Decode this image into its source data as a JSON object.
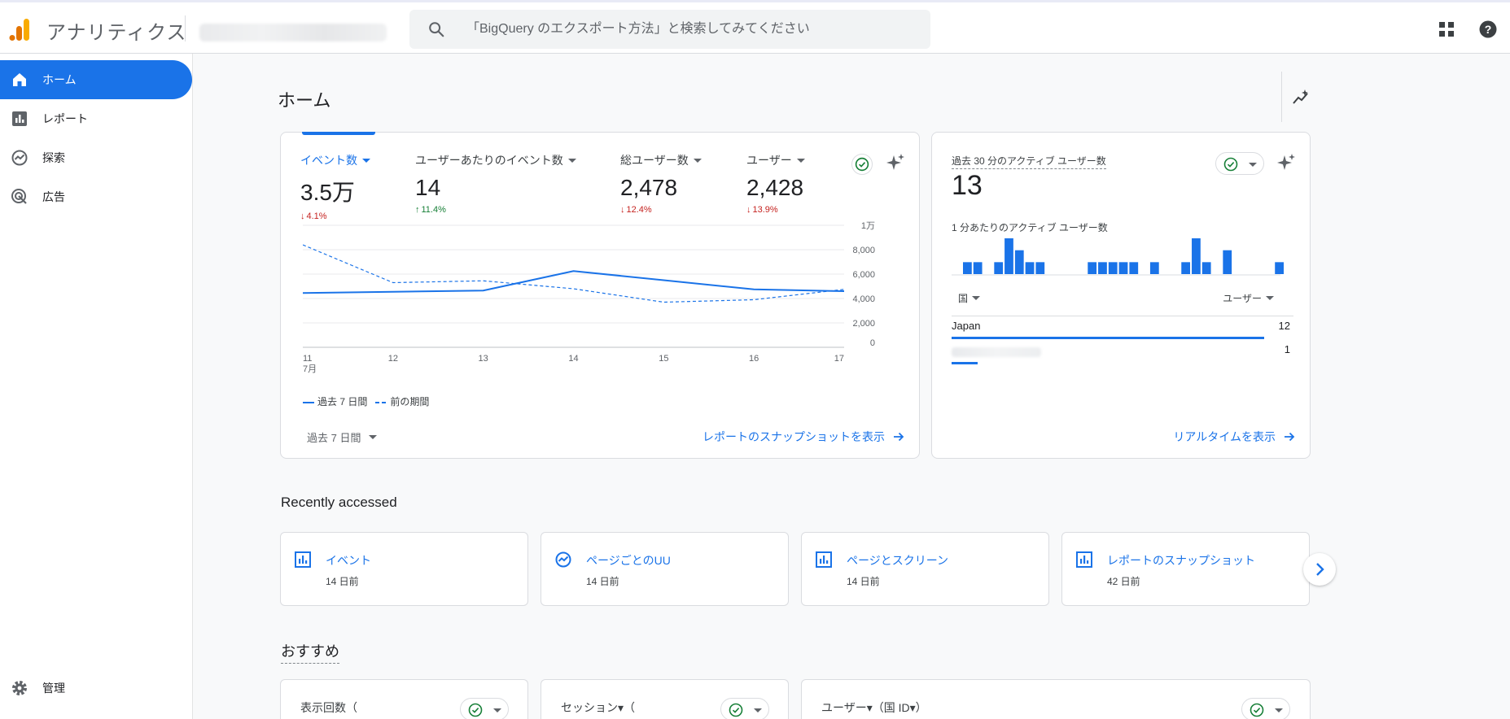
{
  "header": {
    "app_name": "アナリティクス",
    "search_placeholder": "「BigQuery のエクスポート方法」と検索してみてください",
    "icons": [
      "analytics-logo-icon",
      "search-icon",
      "apps-icon",
      "help-icon"
    ]
  },
  "sidebar": {
    "items": [
      {
        "label": "ホーム",
        "icon": "home-icon",
        "active": true
      },
      {
        "label": "レポート",
        "icon": "reports-icon"
      },
      {
        "label": "探索",
        "icon": "explore-icon"
      },
      {
        "label": "広告",
        "icon": "advertising-icon"
      }
    ],
    "admin_label": "管理"
  },
  "main": {
    "title": "ホーム",
    "overview": {
      "metrics": [
        {
          "label": "イベント数",
          "value": "3.5万",
          "change": "4.1%",
          "direction": "down"
        },
        {
          "label": "ユーザーあたりのイベント数",
          "value": "14",
          "change": "11.4%",
          "direction": "up"
        },
        {
          "label": "総ユーザー数",
          "value": "2,478",
          "change": "12.4%",
          "direction": "down"
        },
        {
          "label": "ユーザー",
          "value": "2,428",
          "change": "13.9%",
          "direction": "down"
        }
      ],
      "legend": {
        "current": "過去 7 日間",
        "previous": "前の期間"
      },
      "date_range": "過去 7 日間",
      "snapshot_link": "レポートのスナップショットを表示"
    },
    "realtime": {
      "title": "過去 30 分のアクティブ ユーザー数",
      "value": "13",
      "subtitle": "1 分あたりのアクティブ ユーザー数",
      "col_country": "国",
      "col_users": "ユーザー",
      "rows": [
        {
          "country": "Japan",
          "users": "12",
          "share": 1.0
        },
        {
          "country": "",
          "users": "1",
          "share": 0.083
        }
      ],
      "per_minute": [
        1,
        1,
        0,
        1,
        3,
        2,
        1,
        1,
        0,
        0,
        0,
        0,
        1,
        1,
        1,
        1,
        1,
        0,
        1,
        0,
        0,
        1,
        3,
        1,
        0,
        2,
        0,
        0,
        0,
        0,
        1
      ],
      "link": "リアルタイムを表示"
    },
    "recent": {
      "title": "Recently accessed",
      "items": [
        {
          "title": "イベント",
          "date": "14 日前",
          "icon": "bar-chart-icon"
        },
        {
          "title": "ページごとのUU",
          "date": "14 日前",
          "icon": "explore-icon"
        },
        {
          "title": "ページとスクリーン",
          "date": "14 日前",
          "icon": "bar-chart-icon"
        },
        {
          "title": "レポートのスナップショット",
          "date": "42 日前",
          "icon": "bar-chart-icon"
        }
      ]
    },
    "suggested": {
      "title": "おすすめ",
      "cards": [
        {
          "title": "表示回数（"
        },
        {
          "title": "セッション▾（"
        },
        {
          "title": "ユーザー▾（国 ID▾）"
        }
      ]
    }
  },
  "chart_data": {
    "type": "line",
    "x": [
      "11",
      "12",
      "13",
      "14",
      "15",
      "16",
      "17"
    ],
    "x_sublabel": "7月",
    "y_ticks": [
      "0",
      "2,000",
      "4,000",
      "6,000",
      "8,000",
      "1万"
    ],
    "ylim": [
      0,
      10000
    ],
    "grid": true,
    "series": [
      {
        "name": "過去 7 日間",
        "style": "solid",
        "values": [
          4450,
          4550,
          4650,
          6250,
          5500,
          4750,
          4600
        ]
      },
      {
        "name": "前の期間",
        "style": "dashed",
        "values": [
          8400,
          5300,
          5450,
          4800,
          3700,
          3900,
          4750
        ]
      }
    ],
    "color": "#1a73e8"
  },
  "colors": {
    "accent": "#1a73e8",
    "down": "#c5221f",
    "up": "#188038",
    "logo_orange": "#f9ab00",
    "logo_dark": "#e37400"
  }
}
